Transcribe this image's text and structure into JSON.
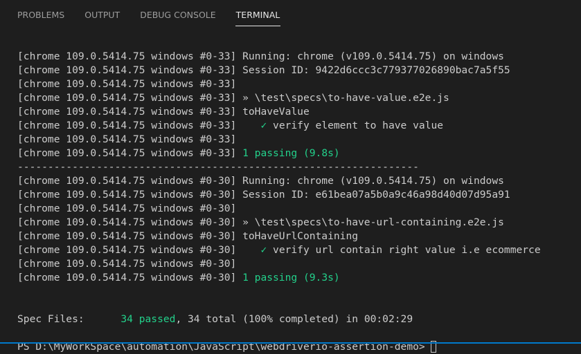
{
  "tabs": [
    "PROBLEMS",
    "OUTPUT",
    "DEBUG CONSOLE",
    "TERMINAL"
  ],
  "active_tab": "TERMINAL",
  "colors": {
    "background": "#1e1e1e",
    "text": "#cccccc",
    "success": "#23d18b",
    "status_bar": "#007acc"
  },
  "terminal": {
    "lines": [
      [
        {
          "t": "[chrome 109.0.5414.75 windows #0-33] Running: chrome (v109.0.5414.75) on windows"
        }
      ],
      [
        {
          "t": "[chrome 109.0.5414.75 windows #0-33] Session ID: 9422d6ccc3c779377026890bac7a5f55"
        }
      ],
      [
        {
          "t": "[chrome 109.0.5414.75 windows #0-33]"
        }
      ],
      [
        {
          "t": "[chrome 109.0.5414.75 windows #0-33] » \\test\\specs\\to-have-value.e2e.js"
        }
      ],
      [
        {
          "t": "[chrome 109.0.5414.75 windows #0-33] toHaveValue"
        }
      ],
      [
        {
          "t": "[chrome 109.0.5414.75 windows #0-33]    "
        },
        {
          "t": "✓",
          "c": "green"
        },
        {
          "t": " verify element to have value"
        }
      ],
      [
        {
          "t": "[chrome 109.0.5414.75 windows #0-33]"
        }
      ],
      [
        {
          "t": "[chrome 109.0.5414.75 windows #0-33] "
        },
        {
          "t": "1 passing (9.8s)",
          "c": "green"
        }
      ],
      [
        {
          "t": "------------------------------------------------------------------"
        }
      ],
      [
        {
          "t": "[chrome 109.0.5414.75 windows #0-30] Running: chrome (v109.0.5414.75) on windows"
        }
      ],
      [
        {
          "t": "[chrome 109.0.5414.75 windows #0-30] Session ID: e61bea07a5b0a9c46a98d40d07d95a91"
        }
      ],
      [
        {
          "t": "[chrome 109.0.5414.75 windows #0-30]"
        }
      ],
      [
        {
          "t": "[chrome 109.0.5414.75 windows #0-30] » \\test\\specs\\to-have-url-containing.e2e.js"
        }
      ],
      [
        {
          "t": "[chrome 109.0.5414.75 windows #0-30] toHaveUrlContaining"
        }
      ],
      [
        {
          "t": "[chrome 109.0.5414.75 windows #0-30]    "
        },
        {
          "t": "✓",
          "c": "green"
        },
        {
          "t": " verify url contain right value i.e ecommerce"
        }
      ],
      [
        {
          "t": "[chrome 109.0.5414.75 windows #0-30]"
        }
      ],
      [
        {
          "t": "[chrome 109.0.5414.75 windows #0-30] "
        },
        {
          "t": "1 passing (9.3s)",
          "c": "green"
        }
      ],
      [],
      [],
      [
        {
          "t": "Spec Files:      "
        },
        {
          "t": "34 passed",
          "c": "green"
        },
        {
          "t": ", 34 total (100% completed) in 00:02:29"
        }
      ],
      []
    ],
    "prompt": "PS D:\\MyWorkSpace\\automation\\JavaScript\\webdriverio-assertion-demo> "
  }
}
